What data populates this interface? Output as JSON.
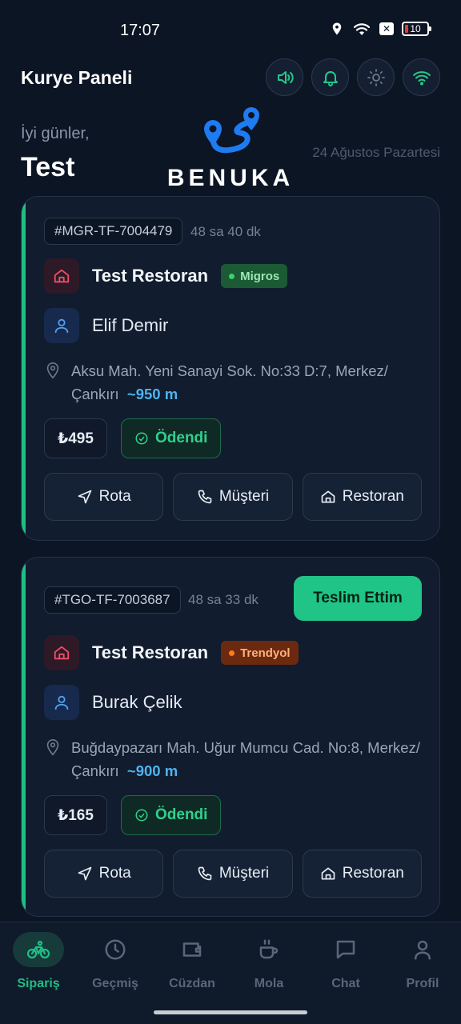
{
  "status_bar": {
    "time": "17:07",
    "battery": "10"
  },
  "header": {
    "title": "Kurye Paneli",
    "greeting": "İyi günler,",
    "username": "Test",
    "date": "24 Ağustos Pazartesi",
    "logo_text": "BENUKA",
    "icons": [
      "speaker-icon",
      "bell-icon",
      "sun-icon",
      "wifi-icon"
    ]
  },
  "orders": [
    {
      "id": "#MGR-TF-7004479",
      "elapsed": "48 sa 40 dk",
      "restaurant": "Test Restoran",
      "platform": "Migros",
      "customer": "Elif Demir",
      "address": "Aksu Mah. Yeni Sanayi Sok. No:33 D:7, Merkez/ Çankırı",
      "distance": "~950 m",
      "price": "₺495",
      "payment_status": "Ödendi",
      "actions": {
        "route": "Rota",
        "customer": "Müşteri",
        "restaurant": "Restoran"
      }
    },
    {
      "id": "#TGO-TF-7003687",
      "elapsed": "48 sa 33 dk",
      "deliver_label": "Teslim Ettim",
      "restaurant": "Test Restoran",
      "platform": "Trendyol",
      "customer": "Burak Çelik",
      "address": "Buğdaypazarı Mah. Uğur Mumcu Cad. No:8, Merkez/Çankırı",
      "distance": "~900 m",
      "price": "₺165",
      "payment_status": "Ödendi",
      "actions": {
        "route": "Rota",
        "customer": "Müşteri",
        "restaurant": "Restoran"
      }
    }
  ],
  "bottom_nav": [
    {
      "label": "Sipariş",
      "icon": "bicycle-icon",
      "active": true
    },
    {
      "label": "Geçmiş",
      "icon": "clock-icon",
      "active": false
    },
    {
      "label": "Cüzdan",
      "icon": "wallet-icon",
      "active": false
    },
    {
      "label": "Mola",
      "icon": "coffee-icon",
      "active": false
    },
    {
      "label": "Chat",
      "icon": "chat-icon",
      "active": false
    },
    {
      "label": "Profil",
      "icon": "user-icon",
      "active": false
    }
  ],
  "colors": {
    "accent": "#1fbf84",
    "background": "#0c1524",
    "distance": "#4fb3f0"
  }
}
